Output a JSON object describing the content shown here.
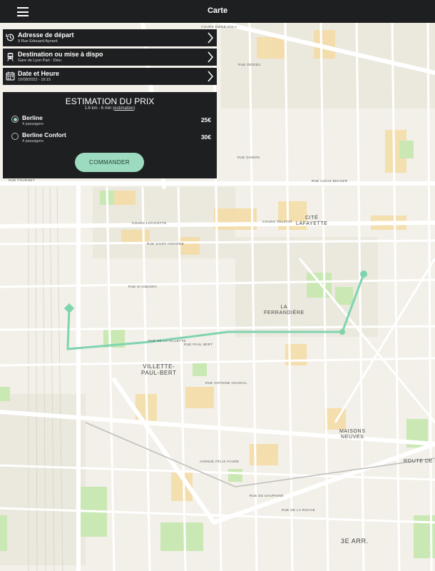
{
  "app": {
    "title": "Carte"
  },
  "steps": [
    {
      "label": "Adresse de départ",
      "value": "9 Rue Edouard Aynard"
    },
    {
      "label": "Destination ou mise à dispo",
      "value": "Gare de Lyon Part - Dieu"
    },
    {
      "label": "Date et Heure",
      "value": "10/08/2022 - 16:15"
    }
  ],
  "estimate": {
    "title": "ESTIMATION DU PRIX",
    "distance_prefix": "1.6 km - 6 min (",
    "link": "estimation",
    "distance_suffix": ")",
    "options": [
      {
        "name": "Berline",
        "passengers": "4 passagers",
        "price": "25€",
        "selected": true
      },
      {
        "name": "Berline Confort",
        "passengers": "4 passagers",
        "price": "30€",
        "selected": false
      }
    ],
    "order_label": "COMMANDER"
  },
  "colors": {
    "accent": "#9cdbbf",
    "route": "#7fd4b0",
    "panel": "#1e1f21"
  },
  "map_labels": {
    "cours_emile_zola": "COURS EMILE ZOLA",
    "rue_fournet": "RUE FOURNET",
    "rue_damon": "RUE DAMON",
    "rue_louis_becker": "RUE LOUIS BECKER",
    "cite_lafayette": "CITÉ\nLAFAYETTE",
    "cours_lafayette": "COURS LAFAYETTE",
    "cours_tolstoi": "COURS TOLSTOÏ",
    "rue_saint_antoine": "RUE SAINT-ANTOINE",
    "rue_daubigny": "RUE D'AUBIGNY",
    "la_ferrandiere": "LA\nFERRANDIÈRE",
    "villette_paul_bert": "VILLETTE-\nPAUL-BERT",
    "maisons_neuves": "MAISONS\nNEUVES",
    "route_de_genas": "ROUTE DE GE",
    "troisieme_arr": "3E ARR.",
    "rue_dedieu": "RUE DEDIEU",
    "rue_paul_bert": "RUE PAUL BERT",
    "rue_antoine_charial": "RUE ANTOINE CHARIAL",
    "avenue_felix_faure": "AVENUE FÉLIX FAURE",
    "rue_du_dauphine": "RUE DU DAUPHINÉ",
    "rue_de_la_villette": "RUE DE LA VILLETTE",
    "rue_de_turin": "RUE DE LA ROCHE"
  }
}
